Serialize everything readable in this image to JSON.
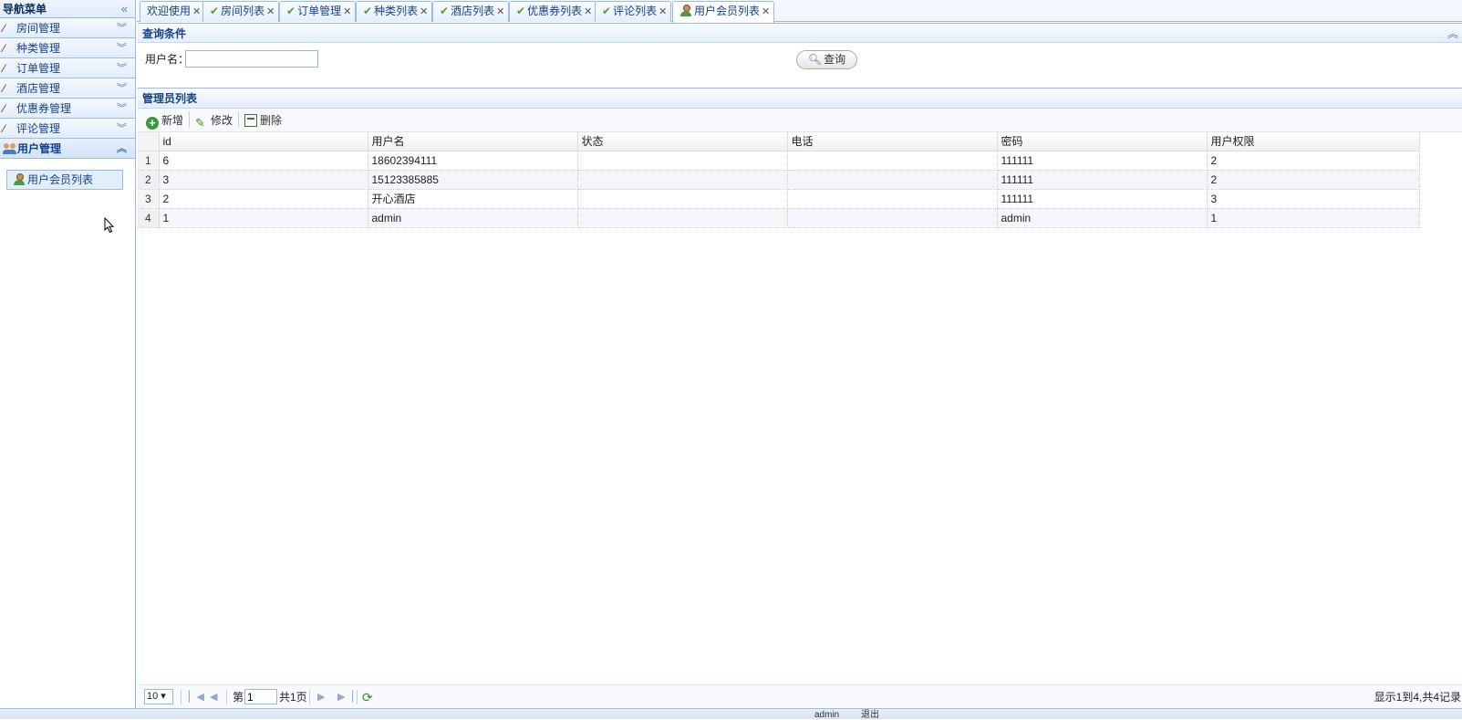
{
  "nav": {
    "title": "导航菜单",
    "items": [
      {
        "label": "房间管理"
      },
      {
        "label": "种类管理"
      },
      {
        "label": "订单管理"
      },
      {
        "label": "酒店管理"
      },
      {
        "label": "优惠券管理"
      },
      {
        "label": "评论管理"
      },
      {
        "label": "用户管理"
      }
    ],
    "sub_item": "用户会员列表"
  },
  "tabs": [
    {
      "label": "欢迎使用"
    },
    {
      "label": "房间列表"
    },
    {
      "label": "订单管理"
    },
    {
      "label": "种类列表"
    },
    {
      "label": "酒店列表"
    },
    {
      "label": "优惠券列表"
    },
    {
      "label": "评论列表"
    },
    {
      "label": "用户会员列表"
    }
  ],
  "query": {
    "title": "查询条件",
    "username_label": "用户名：",
    "username_value": "",
    "search_label": "查询"
  },
  "list": {
    "title": "管理员列表",
    "toolbar": {
      "add": "新增",
      "edit": "修改",
      "delete": "删除"
    },
    "columns": [
      "id",
      "用户名",
      "状态",
      "电话",
      "密码",
      "用户权限"
    ],
    "rows": [
      {
        "n": "1",
        "id": "6",
        "username": "18602394111",
        "status": "",
        "phone": "",
        "password": "111111",
        "role": "2"
      },
      {
        "n": "2",
        "id": "3",
        "username": "15123385885",
        "status": "",
        "phone": "",
        "password": "111111",
        "role": "2"
      },
      {
        "n": "3",
        "id": "2",
        "username": "开心酒店",
        "status": "",
        "phone": "",
        "password": "111111",
        "role": "3"
      },
      {
        "n": "4",
        "id": "1",
        "username": "admin",
        "status": "",
        "phone": "",
        "password": "admin",
        "role": "1"
      }
    ]
  },
  "pager": {
    "page_size": "10 ▾",
    "page_value": "1",
    "page_prefix": "第",
    "page_total": "共1页",
    "info": "显示1到4,共4记录"
  },
  "status": {
    "user": "admin",
    "logout": "退出"
  },
  "icons": {
    "check": "check-icon",
    "close": "close-icon",
    "wand": "wand-icon",
    "user": "user-icon",
    "users": "users-icon"
  },
  "colors": {
    "border": "#99bbe8",
    "header_text": "#15428b",
    "check": "#5a9e2e"
  }
}
